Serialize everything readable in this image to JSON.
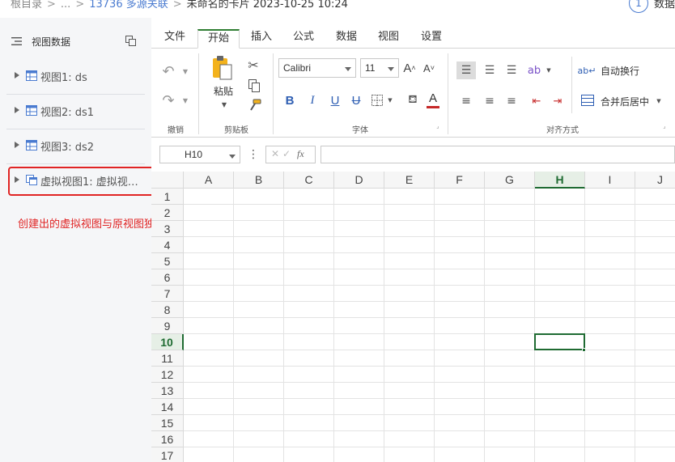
{
  "breadcrumb": {
    "root": "根目录",
    "ellipsis": "...",
    "project": "13736 多源关联",
    "card": "未命名的卡片 2023-10-25 10:24"
  },
  "step": {
    "number": "1",
    "label": "数据"
  },
  "sidebar": {
    "title": "视图数据",
    "items": [
      {
        "label": "视图1: ds",
        "icon": "table-view-icon"
      },
      {
        "label": "视图2: ds1",
        "icon": "table-view-icon"
      },
      {
        "label": "视图3: ds2",
        "icon": "table-view-icon"
      },
      {
        "label": "虚拟视图1: 虚拟视…",
        "icon": "virtual-view-icon"
      }
    ]
  },
  "annotation": {
    "text": "创建出的虚拟视图与原视图独立使用，数据互不影响",
    "color": "#e02424"
  },
  "ribbon": {
    "tabs": [
      "文件",
      "开始",
      "插入",
      "公式",
      "数据",
      "视图",
      "设置"
    ],
    "active_tab": "开始",
    "groups": {
      "undo": "撤销",
      "clipboard": "剪贴板",
      "font": "字体",
      "align": "对齐方式"
    },
    "paste_label": "粘贴",
    "font_name": "Calibri",
    "font_size": "11",
    "wrap_label": "自动换行",
    "merge_label": "合并后居中"
  },
  "formula_bar": {
    "cell_ref": "H10",
    "fx": "fx",
    "value": ""
  },
  "sheet": {
    "columns": [
      "A",
      "B",
      "C",
      "D",
      "E",
      "F",
      "G",
      "H",
      "I",
      "J"
    ],
    "rows": [
      "1",
      "2",
      "3",
      "4",
      "5",
      "6",
      "7",
      "8",
      "9",
      "10",
      "11",
      "12",
      "13",
      "14",
      "15",
      "16",
      "17"
    ],
    "selected_column": "H",
    "selected_row": "10",
    "accent": "#1f6b32"
  }
}
